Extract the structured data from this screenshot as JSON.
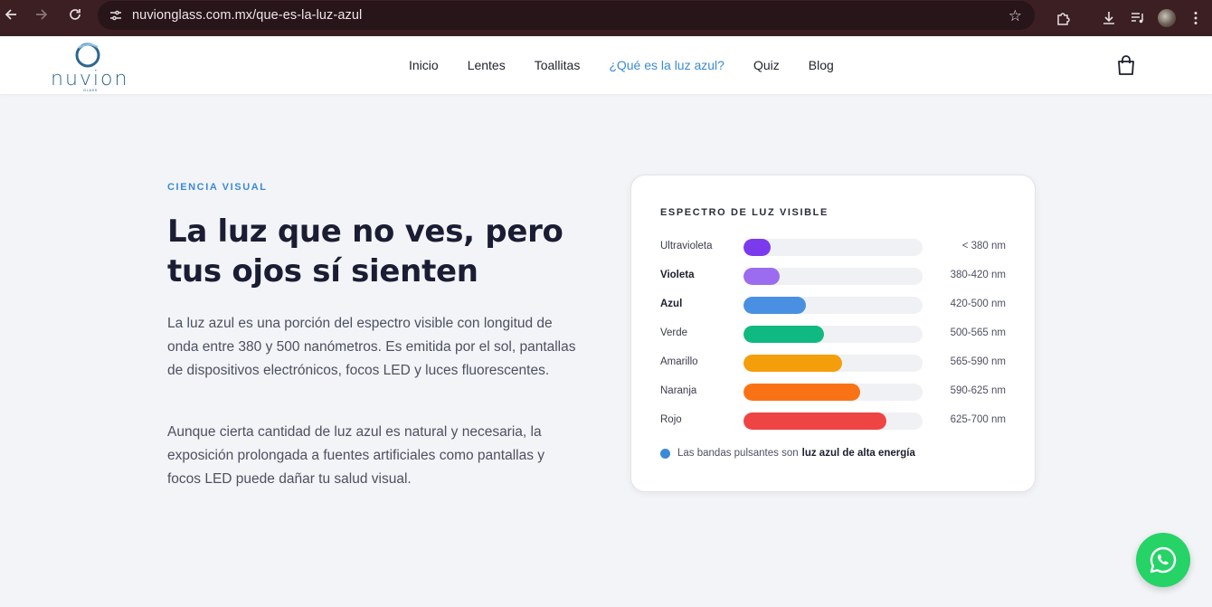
{
  "browser": {
    "url": "nuvionglass.com.mx/que-es-la-luz-azul",
    "back_icon": "arrow-left-icon",
    "forward_icon": "arrow-right-icon",
    "reload_icon": "reload-icon",
    "site_info_icon": "tune-icon",
    "bookmark_icon": "star-icon",
    "extensions_icon": "puzzle-icon",
    "download_icon": "download-icon",
    "media_icon": "media-control-icon",
    "profile_icon": "avatar",
    "menu_icon": "kebab-menu-icon"
  },
  "header": {
    "logo_text": "nuvion",
    "logo_subtext": "GLASS",
    "nav": [
      {
        "label": "Inicio"
      },
      {
        "label": "Lentes"
      },
      {
        "label": "Toallitas"
      },
      {
        "label": "¿Qué es la luz azul?"
      },
      {
        "label": "Quiz"
      },
      {
        "label": "Blog"
      }
    ],
    "active_nav": "¿Qué es la luz azul?",
    "cart_icon": "shopping-bag-icon"
  },
  "hero": {
    "eyebrow": "CIENCIA VISUAL",
    "headline": "La luz que no ves, pero tus ojos sí sienten",
    "paragraph_1": "La luz azul es una porción del espectro visible con longitud de onda entre 380 y 500 nanómetros. Es emitida por el sol, pantallas de dispositivos electrónicos, focos LED y luces fluorescentes.",
    "paragraph_2": "Aunque cierta cantidad de luz azul es natural y necesaria, la exposición prolongada a fuentes artificiales como pantallas y focos LED puede dañar tu salud visual."
  },
  "spectrum": {
    "title": "ESPECTRO DE LUZ VISIBLE",
    "bands": [
      {
        "name": "Ultravioleta",
        "range": "< 380 nm",
        "level": 0.15,
        "color": "#7c3aed",
        "emphasis": false
      },
      {
        "name": "Violeta",
        "range": "380-420 nm",
        "level": 0.2,
        "color": "#9b6cf0",
        "emphasis": true
      },
      {
        "name": "Azul",
        "range": "420-500 nm",
        "level": 0.35,
        "color": "#4a90e2",
        "emphasis": true
      },
      {
        "name": "Verde",
        "range": "500-565 nm",
        "level": 0.45,
        "color": "#10b981",
        "emphasis": false
      },
      {
        "name": "Amarillo",
        "range": "565-590 nm",
        "level": 0.55,
        "color": "#f59e0b",
        "emphasis": false
      },
      {
        "name": "Naranja",
        "range": "590-625 nm",
        "level": 0.65,
        "color": "#f97316",
        "emphasis": false
      },
      {
        "name": "Rojo",
        "range": "625-700 nm",
        "level": 0.8,
        "color": "#ef4444",
        "emphasis": false
      }
    ],
    "legend_prefix": "Las bandas pulsantes son",
    "legend_bold": "luz azul de alta energía",
    "legend_dot_color": "#3a8ad6"
  },
  "whatsapp": {
    "icon": "whatsapp-icon",
    "color": "#25d366"
  }
}
